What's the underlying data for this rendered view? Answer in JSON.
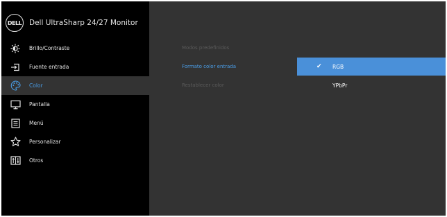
{
  "header": {
    "logo_text": "DELL",
    "title": "Dell UltraSharp 24/27 Monitor"
  },
  "menu": [
    {
      "label": "Brillo/Contraste",
      "icon": "brightness-icon"
    },
    {
      "label": "Fuente entrada",
      "icon": "input-source-icon"
    },
    {
      "label": "Color",
      "icon": "color-palette-icon",
      "active": true
    },
    {
      "label": "Pantalla",
      "icon": "display-icon"
    },
    {
      "label": "Menú",
      "icon": "menu-icon"
    },
    {
      "label": "Personalizar",
      "icon": "star-icon"
    },
    {
      "label": "Otros",
      "icon": "others-icon"
    }
  ],
  "submenu": [
    {
      "label": "Modos predefinidos"
    },
    {
      "label": "Formato color entrada",
      "selected": true
    },
    {
      "label": "Restablecer color"
    }
  ],
  "options": [
    {
      "label": "RGB",
      "selected": true,
      "check": "✔"
    },
    {
      "label": "YPbPr"
    }
  ],
  "colors": {
    "accent": "#4a9ee8",
    "selection": "#4a90d9",
    "sidebar": "#000000",
    "panel": "#333333"
  }
}
